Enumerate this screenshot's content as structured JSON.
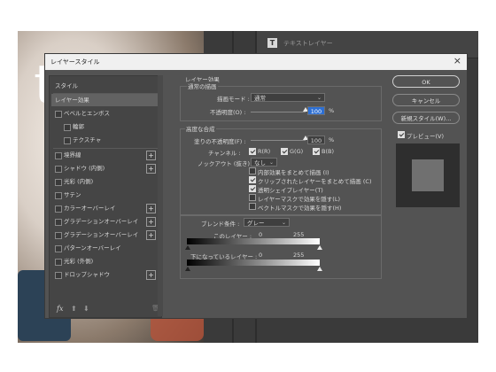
{
  "background": {
    "photo_letter": "t",
    "layers_panel_label": "テキストレイヤー"
  },
  "dialog": {
    "title": "レイヤースタイル",
    "close_glyph": "×"
  },
  "styles_list": {
    "items": [
      {
        "label": "スタイル",
        "checkbox": false,
        "plus": false,
        "selected": false
      },
      {
        "label": "レイヤー効果",
        "checkbox": false,
        "plus": false,
        "selected": true
      },
      {
        "label": "ベベルとエンボス",
        "checkbox": true,
        "plus": false,
        "selected": false
      },
      {
        "label": "輪郭",
        "checkbox": true,
        "plus": false,
        "selected": false
      },
      {
        "label": "テクスチャ",
        "checkbox": true,
        "plus": false,
        "selected": false
      },
      {
        "label": "境界線",
        "checkbox": true,
        "plus": true,
        "selected": false
      },
      {
        "label": "シャドウ (内側)",
        "checkbox": true,
        "plus": true,
        "selected": false
      },
      {
        "label": "光彩 (内側)",
        "checkbox": true,
        "plus": false,
        "selected": false
      },
      {
        "label": "サテン",
        "checkbox": true,
        "plus": false,
        "selected": false
      },
      {
        "label": "カラーオーバーレイ",
        "checkbox": true,
        "plus": true,
        "selected": false
      },
      {
        "label": "グラデーションオーバーレイ",
        "checkbox": true,
        "plus": true,
        "selected": false
      },
      {
        "label": "グラデーションオーバーレイ",
        "checkbox": true,
        "plus": true,
        "selected": false
      },
      {
        "label": "パターンオーバーレイ",
        "checkbox": true,
        "plus": false,
        "selected": false
      },
      {
        "label": "光彩 (外側)",
        "checkbox": true,
        "plus": false,
        "selected": false
      },
      {
        "label": "ドロップシャドウ",
        "checkbox": true,
        "plus": true,
        "selected": false
      }
    ],
    "fx_label": "fx",
    "plus_glyph": "+",
    "up_glyph": "⬆",
    "down_glyph": "⬇",
    "trash_glyph": "🗑"
  },
  "blending": {
    "section_title": "レイヤー効果",
    "general_group": "通常の描画",
    "blend_mode_label": "描画モード :",
    "blend_mode_value": "通常",
    "opacity_label": "不透明度(O) :",
    "opacity_value": "100",
    "opacity_unit": "%",
    "opacity_fraction": 1.0,
    "advanced_group": "高度な合成",
    "fill_opacity_label": "塗りの不透明度(F) :",
    "fill_opacity_value": "100",
    "fill_opacity_unit": "%",
    "fill_opacity_fraction": 1.0,
    "channels_label": "チャンネル :",
    "channels": [
      {
        "label": "R(R)",
        "checked": true
      },
      {
        "label": "G(G)",
        "checked": true
      },
      {
        "label": "B(B)",
        "checked": true
      }
    ],
    "knockout_label": "ノックアウト (抜き) :",
    "knockout_value": "なし",
    "options": [
      {
        "label": "内部効果をまとめて描画 (I)",
        "checked": false
      },
      {
        "label": "クリップされたレイヤーをまとめて描画 (C)",
        "checked": true
      },
      {
        "label": "透明シェイプレイヤー(T)",
        "checked": true
      },
      {
        "label": "レイヤーマスクで効果を隠す(L)",
        "checked": false
      },
      {
        "label": "ベクトルマスクで効果を隠す(H)",
        "checked": false
      }
    ],
    "blend_if_label": "ブレンド条件 :",
    "blend_if_value": "グレー",
    "this_layer_label": "このレイヤー :",
    "this_layer_low": "0",
    "this_layer_high": "255",
    "underlying_label": "下になっているレイヤー :",
    "underlying_low": "0",
    "underlying_high": "255"
  },
  "buttons": {
    "ok": "OK",
    "cancel": "キャンセル",
    "new_style": "新規スタイル(W)...",
    "preview_label": "プレビュー(V)",
    "preview_checked": true
  }
}
